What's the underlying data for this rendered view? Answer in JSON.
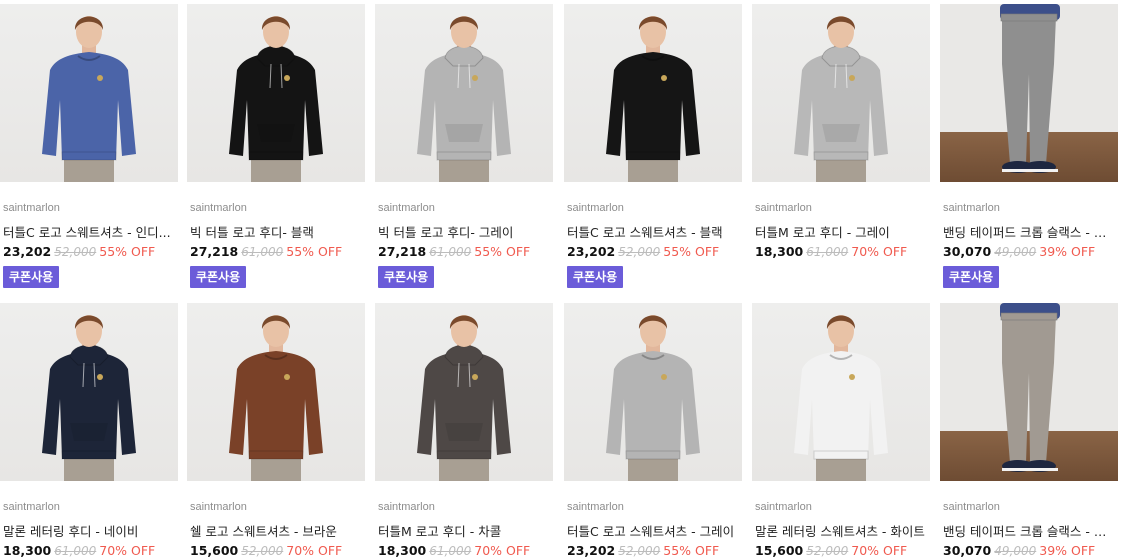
{
  "colors": {
    "discount": "#f05a4f",
    "coupon_bg": "#6b5cd9",
    "brand_text": "#8d8d8d"
  },
  "products": [
    {
      "brand": "saintmarlon",
      "name": "터틀C 로고 스웨트셔츠 - 인디...",
      "price": "23,202",
      "original_price": "52,000",
      "discount": "55% OFF",
      "coupon": "쿠폰사용",
      "garment": "sweatshirt",
      "garment_color": "#4b64a8"
    },
    {
      "brand": "saintmarlon",
      "name": "빅 터틀 로고 후디- 블랙",
      "price": "27,218",
      "original_price": "61,000",
      "discount": "55% OFF",
      "coupon": "쿠폰사용",
      "garment": "hoodie",
      "garment_color": "#141414"
    },
    {
      "brand": "saintmarlon",
      "name": "빅 터틀 로고 후디- 그레이",
      "price": "27,218",
      "original_price": "61,000",
      "discount": "55% OFF",
      "coupon": "쿠폰사용",
      "garment": "hoodie",
      "garment_color": "#b4b4b4"
    },
    {
      "brand": "saintmarlon",
      "name": "터틀C 로고 스웨트셔츠 - 블랙",
      "price": "23,202",
      "original_price": "52,000",
      "discount": "55% OFF",
      "coupon": "쿠폰사용",
      "garment": "sweatshirt",
      "garment_color": "#151515"
    },
    {
      "brand": "saintmarlon",
      "name": "터틀M 로고 후디 - 그레이",
      "price": "18,300",
      "original_price": "61,000",
      "discount": "70% OFF",
      "coupon": "",
      "garment": "hoodie",
      "garment_color": "#b8b8b8"
    },
    {
      "brand": "saintmarlon",
      "name": "밴딩 테이퍼드 크롭 슬랙스 - 그...",
      "price": "30,070",
      "original_price": "49,000",
      "discount": "39% OFF",
      "coupon": "쿠폰사용",
      "garment": "slacks",
      "garment_color": "#8f8f8f"
    },
    {
      "brand": "saintmarlon",
      "name": "말론 레터링 후디 - 네이비",
      "price": "18,300",
      "original_price": "61,000",
      "discount": "70% OFF",
      "coupon": "",
      "garment": "hoodie",
      "garment_color": "#1d2538"
    },
    {
      "brand": "saintmarlon",
      "name": "쉘 로고 스웨트셔츠 - 브라운",
      "price": "15,600",
      "original_price": "52,000",
      "discount": "70% OFF",
      "coupon": "",
      "garment": "sweatshirt",
      "garment_color": "#7a4128"
    },
    {
      "brand": "saintmarlon",
      "name": "터틀M 로고 후디 - 차콜",
      "price": "18,300",
      "original_price": "61,000",
      "discount": "70% OFF",
      "coupon": "",
      "garment": "hoodie",
      "garment_color": "#4e4846"
    },
    {
      "brand": "saintmarlon",
      "name": "터틀C 로고 스웨트셔츠 - 그레이",
      "price": "23,202",
      "original_price": "52,000",
      "discount": "55% OFF",
      "coupon": "",
      "garment": "sweatshirt",
      "garment_color": "#b4b4b4"
    },
    {
      "brand": "saintmarlon",
      "name": "말론 레터링 스웨트셔츠 - 화이트",
      "price": "15,600",
      "original_price": "52,000",
      "discount": "70% OFF",
      "coupon": "",
      "garment": "sweatshirt",
      "garment_color": "#f2f2f2"
    },
    {
      "brand": "saintmarlon",
      "name": "밴딩 테이퍼드 크롭 슬랙스 - 모...",
      "price": "30,070",
      "original_price": "49,000",
      "discount": "39% OFF",
      "coupon": "",
      "garment": "slacks",
      "garment_color": "#a19a92"
    }
  ]
}
